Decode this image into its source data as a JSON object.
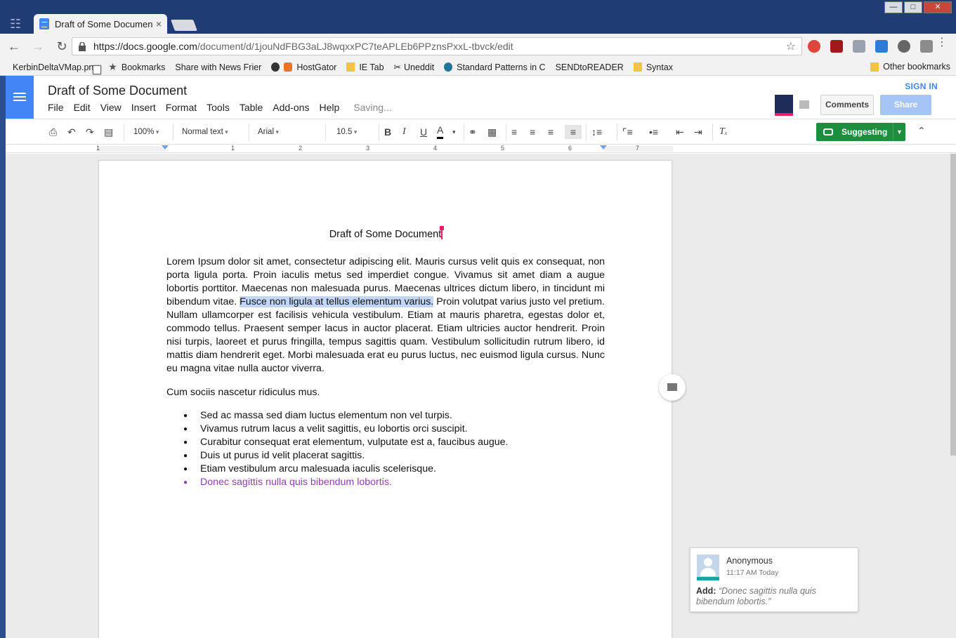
{
  "browser": {
    "tab_title": "Draft of Some Document",
    "tab_close": "×",
    "url_host": "https://docs.google.com",
    "url_path": "/document/d/1jouNdFBG3aLJ8wqxxPC7teAPLEb6PPznsPxxL-tbvck/edit",
    "bookmarks": [
      {
        "label": "KerbinDeltaVMap.png",
        "icon": "page-icon"
      },
      {
        "label": "Bookmarks",
        "icon": "star-icon"
      },
      {
        "label": "Share with News Frier",
        "icon": "page-icon"
      },
      {
        "label": "HostGator",
        "icon": "hostgator-icon"
      },
      {
        "label": "IE Tab",
        "icon": "folder-icon"
      },
      {
        "label": "Uneddit",
        "icon": "scissors-icon"
      },
      {
        "label": "Standard Patterns in C",
        "icon": "wordpress-icon"
      },
      {
        "label": "SENDtoREADER",
        "icon": "page-icon"
      },
      {
        "label": "Syntax",
        "icon": "folder-icon"
      }
    ],
    "other_bookmarks": "Other bookmarks"
  },
  "docs": {
    "title": "Draft of Some Document",
    "menu": [
      "File",
      "Edit",
      "View",
      "Insert",
      "Format",
      "Tools",
      "Table",
      "Add-ons",
      "Help"
    ],
    "saving_status": "Saving...",
    "sign_in": "SIGN IN",
    "comments_button": "Comments",
    "share_button": "Share",
    "toolbar": {
      "zoom": "100%",
      "style": "Normal text",
      "font": "Arial",
      "font_size": "10.5",
      "mode": "Suggesting"
    },
    "ruler_numbers": [
      "1",
      "1",
      "2",
      "3",
      "4",
      "5",
      "6",
      "7"
    ],
    "colors": {
      "brand_blue": "#4285f4",
      "suggest_green": "#1e8e3e",
      "suggestion_purple": "#8e3fac",
      "highlight": "#c2d7f6"
    }
  },
  "document": {
    "heading": "Draft of Some Document",
    "para1_before": "Lorem Ipsum dolor sit amet, consectetur adipiscing elit. Mauris cursus velit quis ex consequat, non porta ligula porta. Proin iaculis metus sed imperdiet congue. Vivamus sit amet diam a augue lobortis porttitor. Maecenas non malesuada purus. Maecenas ultrices dictum libero, in tincidunt mi bibendum vitae. ",
    "para1_highlight": "Fusce non ligula at tellus elementum varius.",
    "para1_after": " Proin volutpat varius justo vel pretium. Nullam ullamcorper est facilisis vehicula vestibulum. Etiam at mauris pharetra, egestas dolor et, commodo tellus. Praesent semper lacus in auctor placerat. Etiam ultricies auctor hendrerit. Proin nisi turpis, laoreet et purus fringilla, tempus sagittis quam. Vestibulum sollicitudin rutrum libero, id mattis diam hendrerit eget. Morbi malesuada erat eu purus luctus, nec euismod ligula cursus. Nunc eu magna vitae nulla auctor viverra.",
    "para2": "Cum sociis nascetur ridiculus mus.",
    "list": [
      "Sed ac massa sed diam luctus elementum non vel turpis.",
      "Vivamus rutrum lacus a velit sagittis, eu lobortis orci suscipit.",
      "Curabitur consequat erat elementum, vulputate est a, faucibus augue.",
      "Duis ut purus id velit placerat sagittis.",
      "Etiam vestibulum arcu malesuada iaculis scelerisque."
    ],
    "suggested_item": "Donec sagittis nulla quis bibendum lobortis."
  },
  "comment": {
    "author": "Anonymous",
    "time": "11:17 AM Today",
    "action": "Add:",
    "text": "“Donec sagittis nulla quis bibendum lobortis.”"
  }
}
